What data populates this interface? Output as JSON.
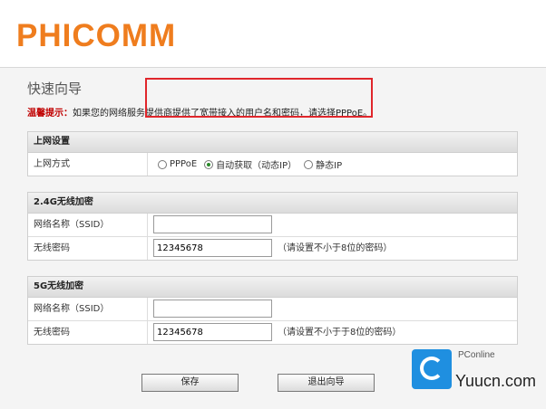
{
  "header": {
    "logo_text": "PHICOMM",
    "brand_color": "#ef7d1e"
  },
  "page": {
    "title": "快速向导",
    "tip_label": "温馨提示：",
    "tip_text": "如果您的网络服务提供商提供了宽带接入的用户名和密码，请选择PPPoE。"
  },
  "internet": {
    "section_title": "上网设置",
    "mode_label": "上网方式",
    "options": [
      {
        "label": "PPPoE",
        "selected": false
      },
      {
        "label": "自动获取（动态IP）",
        "selected": true
      },
      {
        "label": "静态IP",
        "selected": false
      }
    ]
  },
  "wifi_24": {
    "section_title": "2.4G无线加密",
    "ssid_label": "网络名称（SSID）",
    "ssid_value": "",
    "password_label": "无线密码",
    "password_value": "12345678",
    "password_hint": "（请设置不小于8位的密码）"
  },
  "wifi_5": {
    "section_title": "5G无线加密",
    "ssid_label": "网络名称（SSID）",
    "ssid_value": "",
    "password_label": "无线密码",
    "password_value": "12345678",
    "password_hint": "（请设置不小于于8位的密码）"
  },
  "buttons": {
    "save": "保存",
    "exit": "退出向导"
  },
  "watermark": {
    "top_text": "PConline",
    "main_text": "Yuucn.com",
    "icon": "pconline-logo-icon"
  },
  "colors": {
    "highlight": "#e0262b",
    "tip_label": "#c00000"
  }
}
